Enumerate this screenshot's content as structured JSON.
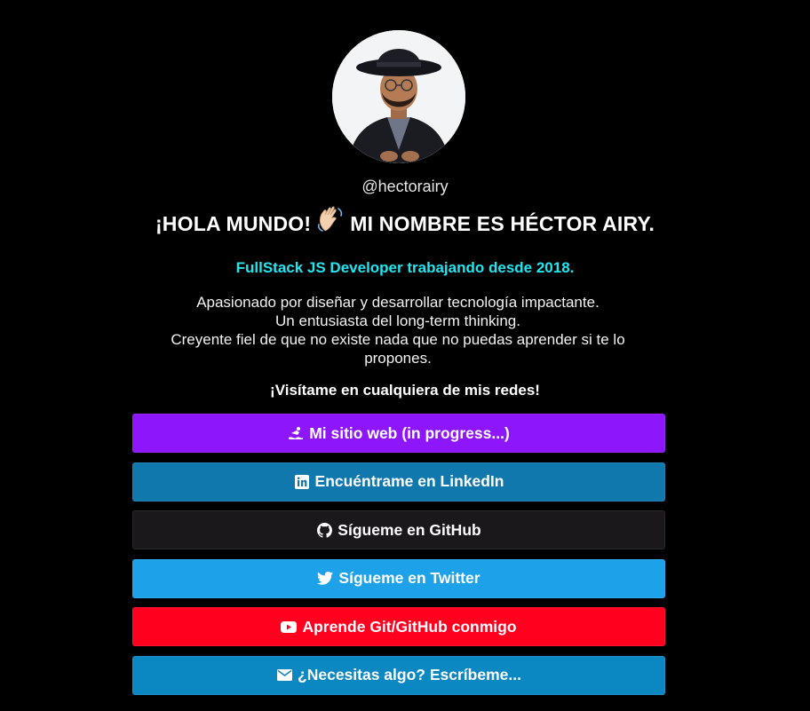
{
  "profile": {
    "handle": "@hectorairy",
    "headline_part1": "¡HOLA MUNDO!",
    "headline_part2": "MI NOMBRE ES HÉCTOR AIRY.",
    "role": "FullStack JS Developer trabajando desde 2018.",
    "bio": [
      "Apasionado por diseñar y desarrollar tecnología impactante.",
      "Un entusiasta del long-term thinking.",
      "Creyente fiel de que no existe nada que no puedas aprender si te lo propones."
    ],
    "cta": "¡Visítame en cualquiera de mis redes!"
  },
  "links": [
    {
      "label": "Mi sitio web (in progress...)",
      "icon": "surfer-icon",
      "color": "#8e16fa"
    },
    {
      "label": "Encuéntrame en LinkedIn",
      "icon": "linkedin-icon",
      "color": "#1178ad"
    },
    {
      "label": "Sígueme en GitHub",
      "icon": "github-icon",
      "color": "#1a181b"
    },
    {
      "label": "Sígueme en Twitter",
      "icon": "twitter-icon",
      "color": "#1da1e8"
    },
    {
      "label": "Aprende Git/GitHub conmigo",
      "icon": "youtube-icon",
      "color": "#ff001e"
    },
    {
      "label": "¿Necesitas algo? Escríbeme...",
      "icon": "mail-icon",
      "color": "#0b87c2"
    }
  ],
  "colors": {
    "background": "#000000",
    "accent_role": "#21e6f0"
  }
}
